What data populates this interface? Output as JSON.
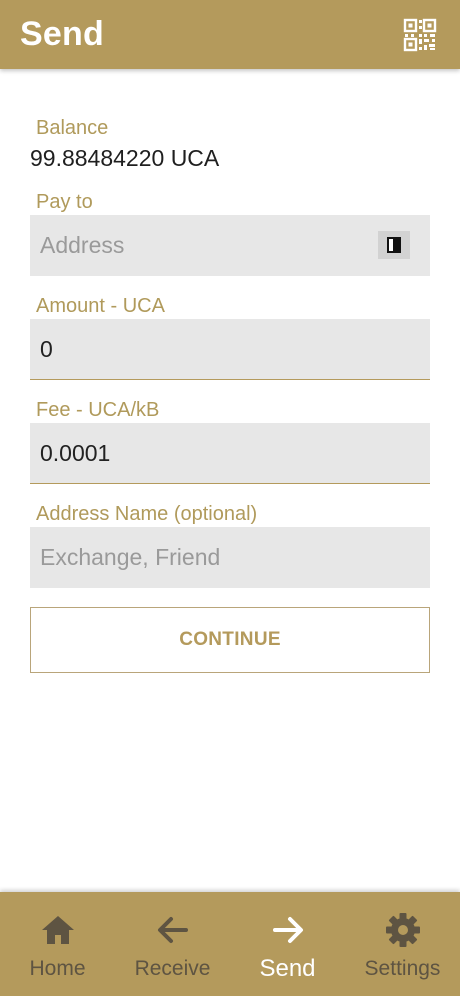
{
  "header": {
    "title": "Send",
    "qr_icon": "qr-code-icon"
  },
  "form": {
    "balance": {
      "label": "Balance",
      "value": "99.88484220 UCA"
    },
    "pay_to": {
      "label": "Pay to",
      "placeholder": "Address",
      "value": "",
      "icon": "address-book-icon"
    },
    "amount": {
      "label": "Amount - UCA",
      "value": "0"
    },
    "fee": {
      "label": "Fee - UCA/kB",
      "value": "0.0001"
    },
    "address_name": {
      "label": "Address Name (optional)",
      "placeholder": "Exchange, Friend",
      "value": ""
    },
    "continue_label": "CONTINUE"
  },
  "bottom_nav": {
    "active": "Send",
    "items": [
      {
        "label": "Home",
        "icon": "home-icon"
      },
      {
        "label": "Receive",
        "icon": "arrow-left-icon"
      },
      {
        "label": "Send",
        "icon": "arrow-right-icon"
      },
      {
        "label": "Settings",
        "icon": "gear-icon"
      }
    ]
  },
  "colors": {
    "brand": "#b49a5c",
    "label": "#b09a5b",
    "input_background": "#e7e7e7",
    "nav_inactive": "#5e5442",
    "nav_active": "#ffffff"
  }
}
